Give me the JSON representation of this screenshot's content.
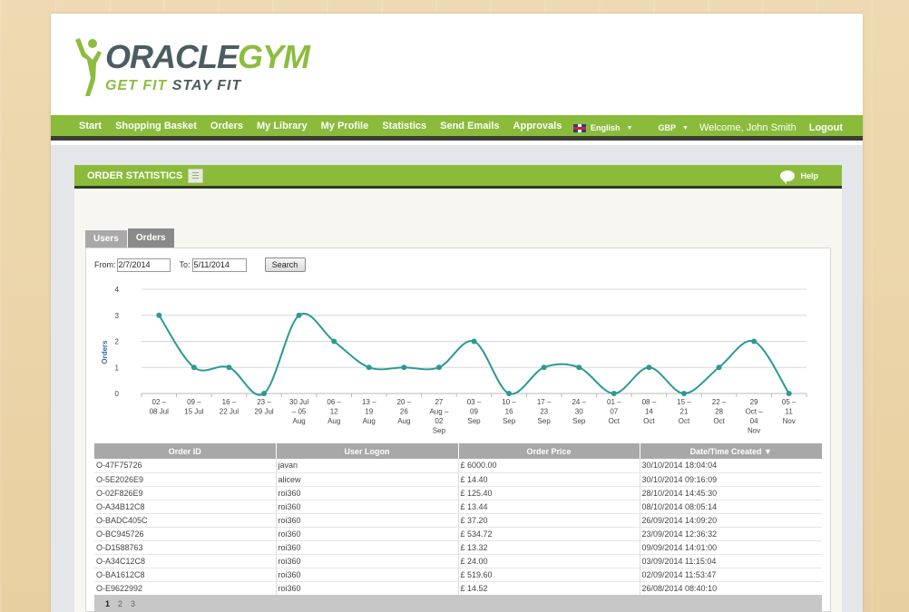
{
  "logo": {
    "title_part1": "ORACLE",
    "title_part2": "GYM",
    "tag_part1": "GET FIT ",
    "tag_part2": "STAY FIT"
  },
  "nav": {
    "items": [
      "Start",
      "Shopping Basket",
      "Orders",
      "My Library",
      "My Profile",
      "Statistics",
      "Send Emails",
      "Approvals"
    ],
    "language": "English",
    "currency": "GBP",
    "welcome": "Welcome, John Smith",
    "logout": "Logout"
  },
  "panel": {
    "title": "ORDER STATISTICS",
    "help": "Help"
  },
  "tabs": {
    "users": "Users",
    "orders": "Orders"
  },
  "filters": {
    "from_label": "From:",
    "from_value": "2/7/2014",
    "to_label": "To:",
    "to_value": "5/11/2014",
    "search": "Search"
  },
  "chart_data": {
    "type": "line",
    "ylabel": "Orders",
    "ylim": [
      0,
      4
    ],
    "yticks": [
      0,
      1,
      2,
      3,
      4
    ],
    "categories": [
      [
        "02 –",
        "08 Jul"
      ],
      [
        "09 –",
        "15 Jul"
      ],
      [
        "16 –",
        "22 Jul"
      ],
      [
        "23 –",
        "29 Jul"
      ],
      [
        "30 Jul",
        "– 05",
        "Aug"
      ],
      [
        "06 –",
        "12",
        "Aug"
      ],
      [
        "13 –",
        "19",
        "Aug"
      ],
      [
        "20 –",
        "26",
        "Aug"
      ],
      [
        "27",
        "Aug –",
        "02",
        "Sep"
      ],
      [
        "03 –",
        "09",
        "Sep"
      ],
      [
        "10 –",
        "16",
        "Sep"
      ],
      [
        "17 –",
        "23",
        "Sep"
      ],
      [
        "24 –",
        "30",
        "Sep"
      ],
      [
        "01 –",
        "07",
        "Oct"
      ],
      [
        "08 –",
        "14",
        "Oct"
      ],
      [
        "15 –",
        "21",
        "Oct"
      ],
      [
        "22 –",
        "28",
        "Oct"
      ],
      [
        "29",
        "Oct –",
        "04",
        "Nov"
      ],
      [
        "05 –",
        "11",
        "Nov"
      ]
    ],
    "values": [
      3,
      1,
      1,
      0,
      3,
      2,
      1,
      1,
      1,
      2,
      0,
      1,
      1,
      0,
      1,
      0,
      1,
      2,
      0
    ],
    "line_color": "#2a9a93",
    "grid": true
  },
  "table": {
    "headers": [
      "Order ID",
      "User Logon",
      "Order Price",
      "Date/Time Created ▼"
    ],
    "rows": [
      [
        "O-47F75726",
        "javan",
        "£ 6000.00",
        "30/10/2014 18:04:04"
      ],
      [
        "O-5E2026E9",
        "alicew",
        "£ 14.40",
        "30/10/2014 09:16:09"
      ],
      [
        "O-02F826E9",
        "roi360",
        "£ 125.40",
        "28/10/2014 14:45:30"
      ],
      [
        "O-A34B12C8",
        "roi360",
        "£ 13.44",
        "08/10/2014 08:05:14"
      ],
      [
        "O-BADC405C",
        "roi360",
        "£ 37.20",
        "26/09/2014 14:09:20"
      ],
      [
        "O-BC945726",
        "roi360",
        "£ 534.72",
        "23/09/2014 12:36:32"
      ],
      [
        "O-D1588763",
        "roi360",
        "£ 13.32",
        "09/09/2014 14:01:00"
      ],
      [
        "O-A34C12C8",
        "roi360",
        "£ 24.00",
        "03/09/2014 11:15:04"
      ],
      [
        "O-BA1612C8",
        "roi360",
        "£ 519.60",
        "02/09/2014 11:53:47"
      ],
      [
        "O-E9622992",
        "roi360",
        "£ 14.52",
        "26/08/2014 08:40:10"
      ]
    ]
  },
  "pager": {
    "pages": [
      "1",
      "2",
      "3"
    ],
    "current": "1"
  },
  "colors": {
    "brand_green": "#8bbb3b",
    "dark_slate": "#4a5d61",
    "chart_teal": "#2a9a93"
  }
}
